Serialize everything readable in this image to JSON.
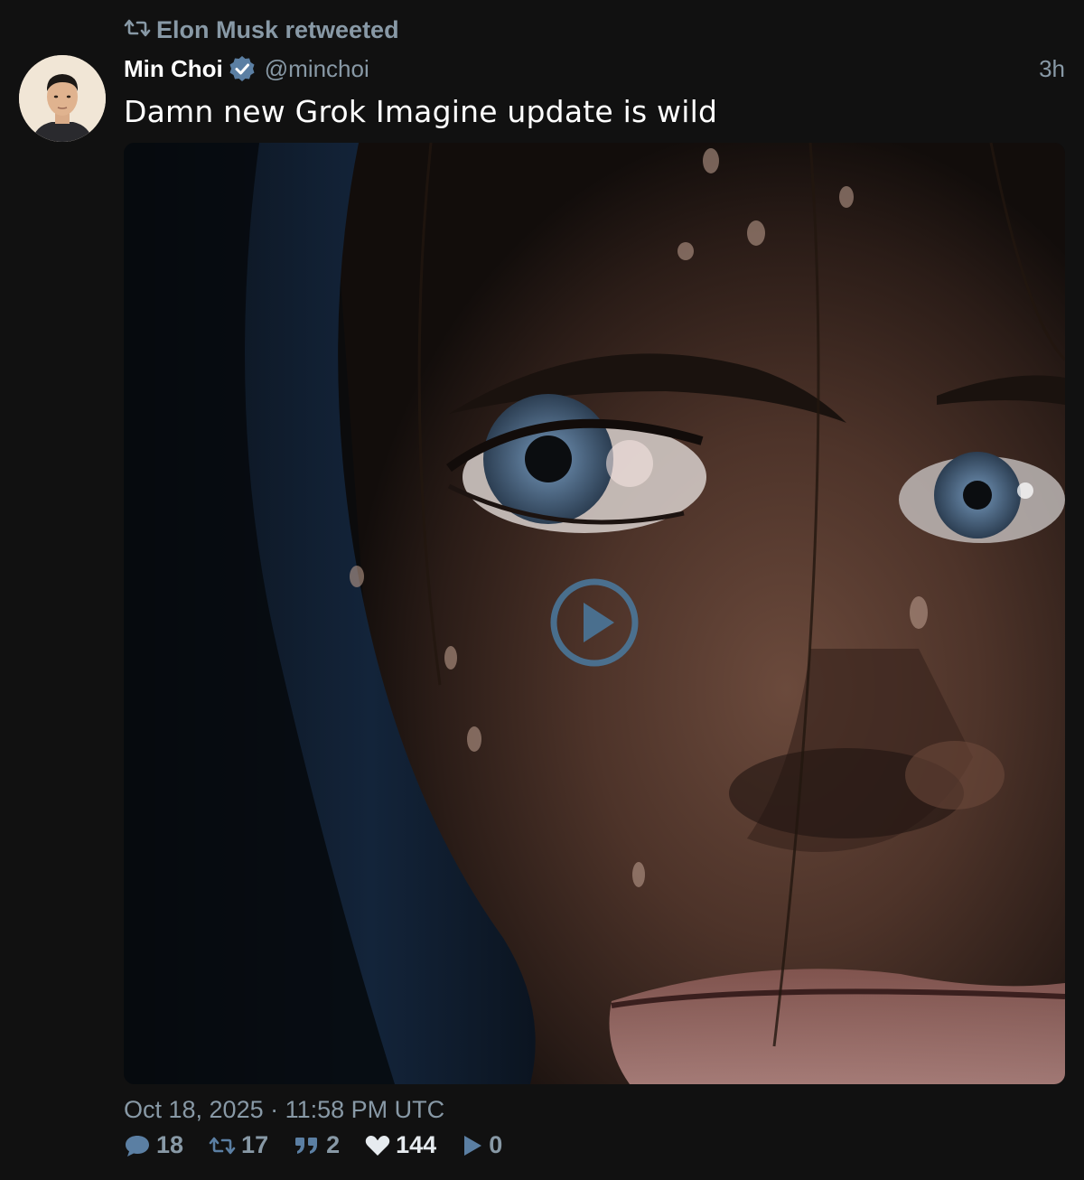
{
  "retweet_banner": {
    "label": "Elon Musk retweeted",
    "icon": "retweet-icon"
  },
  "author": {
    "display_name": "Min Choi",
    "handle": "@minchoi",
    "verified": true,
    "avatar": "avatar-photo"
  },
  "relative_time": "3h",
  "tweet_text": "Damn new Grok Imagine update is wild",
  "media": {
    "type": "video",
    "play_icon": "play-icon"
  },
  "date_line": "Oct 18, 2025 · 11:58 PM UTC",
  "stats": {
    "replies": "18",
    "retweets": "17",
    "quotes": "2",
    "likes": "144",
    "views": "0"
  },
  "colors": {
    "background": "#111111",
    "muted_text": "#8899a6",
    "accent": "#4a7aa0"
  }
}
